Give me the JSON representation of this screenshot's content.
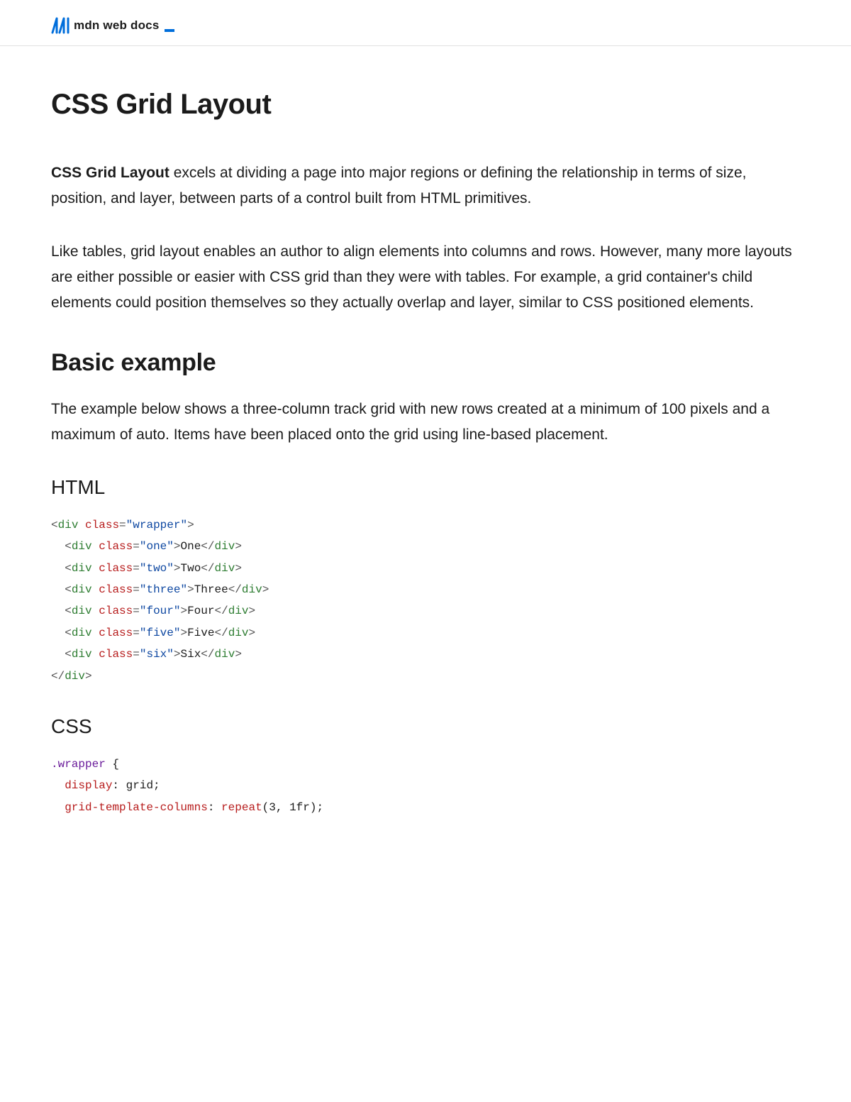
{
  "header": {
    "brand": "mdn web docs"
  },
  "page": {
    "title": "CSS Grid Layout",
    "intro_strong": "CSS Grid Layout",
    "intro_rest": " excels at dividing a page into major regions or defining the relationship in terms of size, position, and layer, between parts of a control built from HTML primitives.",
    "para2": "Like tables, grid layout enables an author to align elements into columns and rows. However, many more layouts are either possible or easier with CSS grid than they were with tables. For example, a grid container's child elements could position themselves so they actually overlap and layer, similar to CSS positioned elements.",
    "h2_basic": "Basic example",
    "para3": "The example below shows a three-column track grid with new rows created at a minimum of 100 pixels and a maximum of auto. Items have been placed onto the grid using line-based placement.",
    "h3_html": "HTML",
    "h3_css": "CSS"
  },
  "code": {
    "html": {
      "t_div": "div",
      "t_class": "class",
      "v_wrapper": "\"wrapper\"",
      "v_one": "\"one\"",
      "v_two": "\"two\"",
      "v_three": "\"three\"",
      "v_four": "\"four\"",
      "v_five": "\"five\"",
      "v_six": "\"six\"",
      "txt_one": "One",
      "txt_two": "Two",
      "txt_three": "Three",
      "txt_four": "Four",
      "txt_five": "Five",
      "txt_six": "Six"
    },
    "css": {
      "sel_wrapper": ".wrapper",
      "brace_open": " {",
      "prop_display": "display",
      "val_grid": " grid",
      "prop_gtc": "grid-template-columns",
      "fn_repeat": " repeat",
      "args_repeat": "(3, 1fr)",
      "colon": ":",
      "semi": ";"
    }
  }
}
